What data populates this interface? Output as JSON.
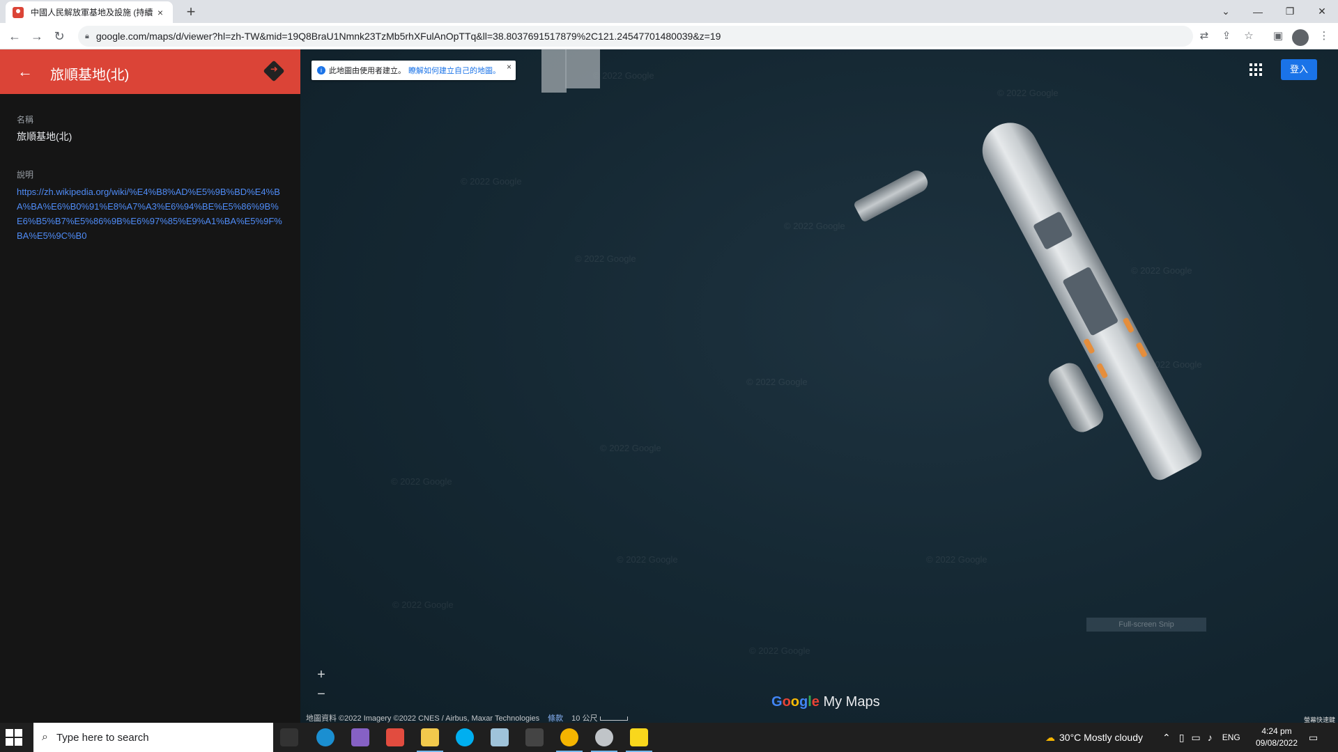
{
  "browser": {
    "tab_title": "中國人民解放軍基地及設施 (持續",
    "tab_close": "×",
    "new_tab": "+",
    "url": "google.com/maps/d/viewer?hl=zh-TW&mid=19Q8BraU1Nmnk23TzMb5rhXFulAnOpTTq&ll=38.8037691517879%2C121.24547701480039&z=19"
  },
  "sidebar": {
    "title": "旅順基地(北)",
    "name_label": "名稱",
    "name_value": "旅順基地(北)",
    "desc_label": "說明",
    "desc_link": "https://zh.wikipedia.org/wiki/%E4%B8%AD%E5%9B%BD%E4%BA%BA%E6%B0%91%E8%A7%A3%E6%94%BE%E5%86%9B%E6%B5%B7%E5%86%9B%E6%97%85%E9%A1%BA%E5%9F%BA%E5%9C%B0"
  },
  "map": {
    "banner_text": "此地圖由使用者建立。",
    "banner_link": "瞭解如何建立自己的地圖。",
    "banner_close": "×",
    "watermark": "© 2022 Google",
    "sign_in": "登入",
    "zoom_in": "+",
    "zoom_out": "−",
    "logo_google": "Google",
    "logo_mymaps": "My Maps",
    "attribution": "地圖資料 ©2022 Imagery ©2022 CNES / Airbus, Maxar Technologies",
    "terms": "條款",
    "scale": "10 公尺",
    "snip_label": "Full-screen Snip",
    "corner_label": "螢幕快速鍵"
  },
  "taskbar": {
    "search_placeholder": "Type here to search",
    "weather": "30°C  Mostly cloudy",
    "lang": "ENG",
    "time": "4:24 pm",
    "date": "09/08/2022"
  }
}
